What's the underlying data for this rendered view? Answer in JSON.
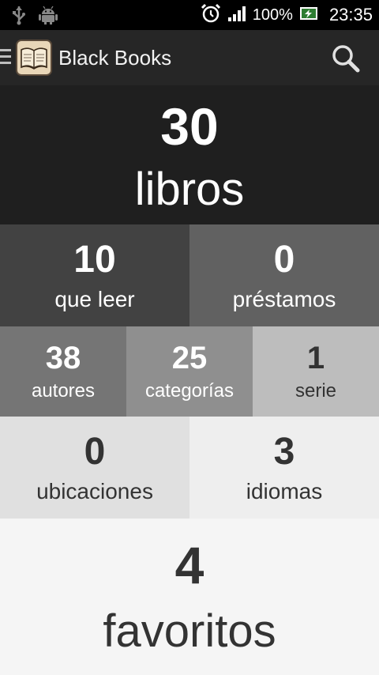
{
  "status_bar": {
    "battery": "100%",
    "time": "23:35"
  },
  "app_bar": {
    "title": "Black Books"
  },
  "stats": {
    "libros": {
      "value": "30",
      "label": "libros"
    },
    "que_leer": {
      "value": "10",
      "label": "que leer"
    },
    "prestamos": {
      "value": "0",
      "label": "préstamos"
    },
    "autores": {
      "value": "38",
      "label": "autores"
    },
    "categorias": {
      "value": "25",
      "label": "categorías"
    },
    "serie": {
      "value": "1",
      "label": "serie"
    },
    "ubicaciones": {
      "value": "0",
      "label": "ubicaciones"
    },
    "idiomas": {
      "value": "3",
      "label": "idiomas"
    },
    "favoritos": {
      "value": "4",
      "label": "favoritos"
    }
  },
  "colors": {
    "tile_libros": "#1f1f1f",
    "tile_que_leer": "#424242",
    "tile_prestamos": "#616161",
    "tile_autores": "#757575",
    "tile_categorias": "#8f8f8f",
    "tile_serie": "#bdbdbd",
    "tile_ubicaciones": "#e0e0e0",
    "tile_idiomas": "#eeeeee",
    "tile_favoritos": "#f5f5f5"
  }
}
